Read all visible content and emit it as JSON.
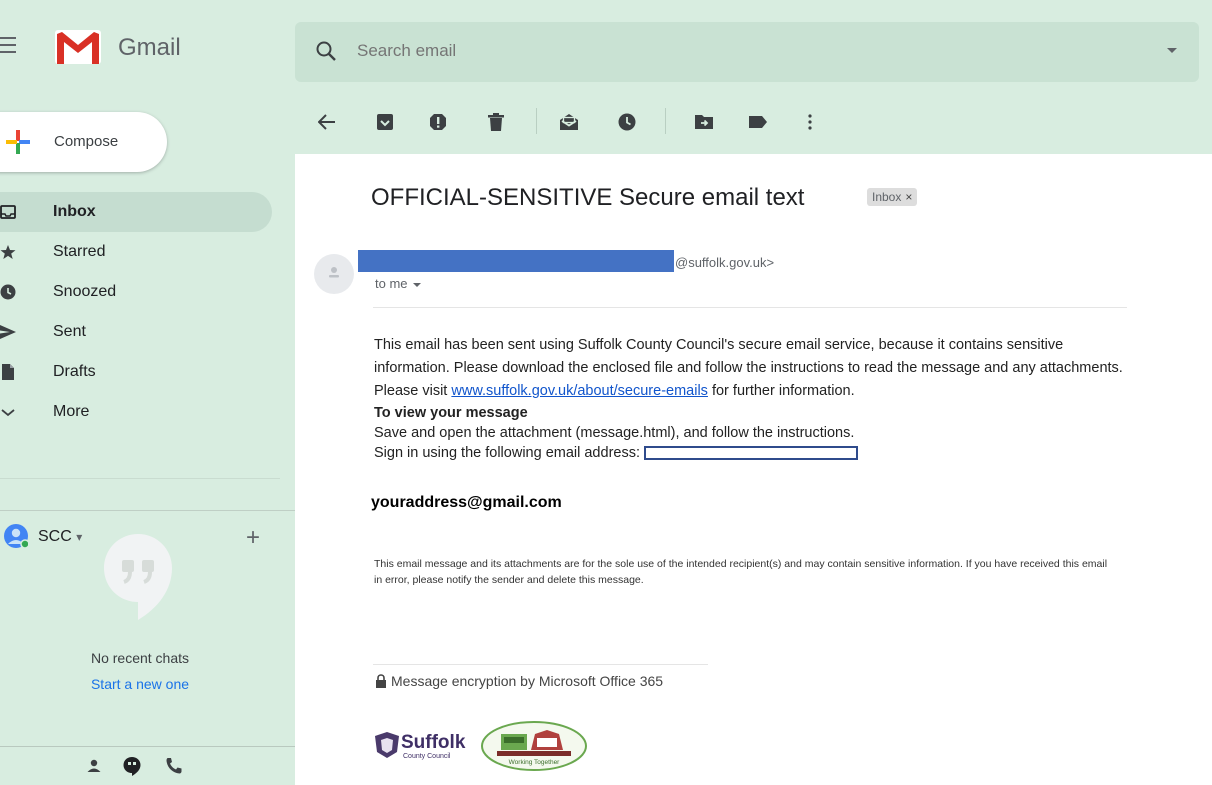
{
  "app": {
    "name": "Gmail",
    "brand_colors": {
      "red": "#d93025",
      "green_bg": "#d8ede0",
      "blue_link": "#1a73e8"
    }
  },
  "search": {
    "placeholder": "Search email"
  },
  "sidebar": {
    "compose_label": "Compose",
    "items": [
      {
        "label": "Inbox",
        "icon": "inbox-icon",
        "active": true
      },
      {
        "label": "Starred",
        "icon": "star-icon",
        "active": false
      },
      {
        "label": "Snoozed",
        "icon": "clock-icon",
        "active": false
      },
      {
        "label": "Sent",
        "icon": "send-icon",
        "active": false
      },
      {
        "label": "Drafts",
        "icon": "draft-icon",
        "active": false
      },
      {
        "label": "More",
        "icon": "chevron-down-icon",
        "active": false
      }
    ],
    "account": {
      "name": "SCC"
    },
    "hangouts": {
      "no_chats": "No recent chats",
      "start_new": "Start a new one"
    }
  },
  "toolbar": {
    "icons": [
      "back-arrow-icon",
      "archive-icon",
      "report-spam-icon",
      "delete-icon",
      "mark-unread-icon",
      "snooze-icon",
      "move-to-icon",
      "label-icon",
      "more-options-icon"
    ]
  },
  "message": {
    "subject": "OFFICIAL-SENSITIVE Secure email text",
    "label": "Inbox",
    "label_close": "×",
    "sender_email_suffix": "@suffolk.gov.uk>",
    "to_line": "to me",
    "body_p1": "This email has been sent using Suffolk County Council's secure email service, because it contains sensitive information. Please download the enclosed file and follow the instructions to read the message and any attachments. Please visit ",
    "body_link": "www.suffolk.gov.uk/about/secure-emails",
    "body_p1_end": " for further information.",
    "view_heading": "To view your message",
    "view_line1": "Save and open the attachment (message.html), and follow the instructions.",
    "view_line2": "Sign in using the following email address:",
    "your_address": "youraddress@gmail.com",
    "disclaimer": "This email message and its attachments are for the sole use of the intended recipient(s) and may contain sensitive information. If you have received this email in error, please notify the sender and delete this message.",
    "encryption": "Message encryption by Microsoft Office 365"
  },
  "logos": {
    "suffolk_main": "Suffolk",
    "suffolk_sub": "County Council",
    "partner_text": "Working Together"
  }
}
